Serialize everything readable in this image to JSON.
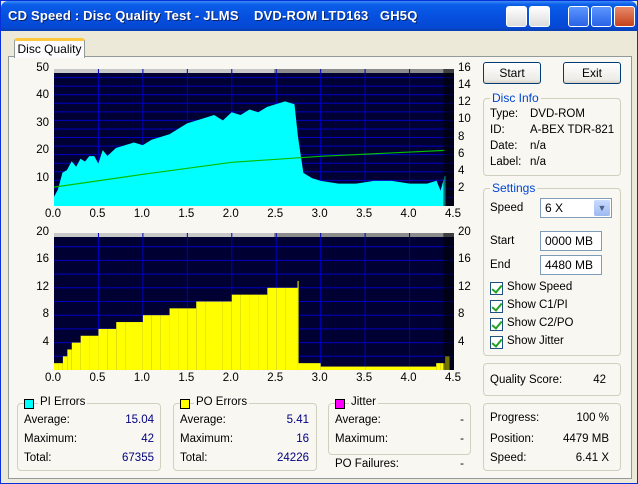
{
  "window": {
    "title": "CD Speed : Disc Quality Test - JLMS    DVD-ROM LTD163   GH5Q"
  },
  "tab": {
    "label": "Disc Quality"
  },
  "buttons": {
    "start": "Start",
    "exit": "Exit"
  },
  "disc_info": {
    "title": "Disc Info",
    "type_label": "Type:",
    "type_value": "DVD-ROM",
    "id_label": "ID:",
    "id_value": "A-BEX TDR-821",
    "date_label": "Date:",
    "date_value": "n/a",
    "label_label": "Label:",
    "label_value": "n/a"
  },
  "settings": {
    "title": "Settings",
    "speed_label": "Speed",
    "speed_value": "6 X",
    "start_label": "Start",
    "start_value": "0000 MB",
    "end_label": "End",
    "end_value": "4480 MB",
    "show_speed": "Show Speed",
    "show_c1pi": "Show C1/PI",
    "show_c2po": "Show C2/PO",
    "show_jitter": "Show Jitter"
  },
  "quality": {
    "label": "Quality Score:",
    "value": "42"
  },
  "progress": {
    "progress_label": "Progress:",
    "progress_value": "100 %",
    "position_label": "Position:",
    "position_value": "4479 MB",
    "speed_label": "Speed:",
    "speed_value": "6.41 X"
  },
  "pi_errors": {
    "title": "PI Errors",
    "avg_label": "Average:",
    "avg": "15.04",
    "max_label": "Maximum:",
    "max": "42",
    "total_label": "Total:",
    "total": "67355"
  },
  "po_errors": {
    "title": "PO Errors",
    "avg_label": "Average:",
    "avg": "5.41",
    "max_label": "Maximum:",
    "max": "16",
    "total_label": "Total:",
    "total": "24226"
  },
  "jitter": {
    "title": "Jitter",
    "avg_label": "Average:",
    "avg": "-",
    "max_label": "Maximum:",
    "max": "-",
    "po_failures_label": "PO Failures:",
    "po_failures": "-"
  },
  "colors": {
    "pi": "#00ffff",
    "po": "#ffff00",
    "jitter": "#ff00ff",
    "speed": "#00c000",
    "plot_bg": "#000033",
    "grid": "#0000c0"
  },
  "chart_data": [
    {
      "type": "area",
      "name": "pi-errors-chart",
      "x_ticks": [
        "0.0",
        "0.5",
        "1.0",
        "1.5",
        "2.0",
        "2.5",
        "3.0",
        "3.5",
        "4.0",
        "4.5"
      ],
      "y_ticks_left": [
        "50",
        "40",
        "30",
        "20",
        "10"
      ],
      "y_ticks_right": [
        "16",
        "14",
        "12",
        "10",
        "8",
        "6",
        "4",
        "2"
      ],
      "xlim": [
        0,
        4.5
      ],
      "ylim": [
        0,
        50
      ],
      "y2lim": [
        0,
        16
      ],
      "series": [
        {
          "x": [
            0.0,
            0.05,
            0.1,
            0.15,
            0.2,
            0.25,
            0.3,
            0.35,
            0.4,
            0.45,
            0.5,
            0.55,
            0.6,
            0.7,
            0.8,
            0.9,
            1.0,
            1.1,
            1.2,
            1.3,
            1.4,
            1.5,
            1.6,
            1.7,
            1.8,
            1.9,
            2.0,
            2.1,
            2.2,
            2.3,
            2.4,
            2.5,
            2.6,
            2.7,
            2.74,
            2.8,
            2.9,
            3.0,
            3.2,
            3.4,
            3.6,
            3.8,
            4.0,
            4.2,
            4.3,
            4.35,
            4.4
          ],
          "y": [
            3,
            6,
            12,
            13,
            16,
            14,
            17,
            16,
            18,
            18,
            15,
            20,
            18,
            21,
            22,
            23,
            22,
            24,
            25,
            26,
            28,
            30,
            31,
            32,
            33,
            31,
            34,
            33,
            35,
            34,
            36,
            37,
            38,
            37,
            25,
            12,
            10,
            9,
            8,
            8,
            9,
            9,
            8,
            8,
            9,
            5,
            11
          ]
        },
        {
          "x": [
            0.0,
            1.0,
            2.0,
            3.0,
            4.0,
            4.4
          ],
          "y": [
            2.2,
            3.7,
            5.1,
            5.8,
            6.3,
            6.5
          ]
        }
      ]
    },
    {
      "type": "bar",
      "name": "po-errors-chart",
      "x_ticks": [
        "0.0",
        "0.5",
        "1.0",
        "1.5",
        "2.0",
        "2.5",
        "3.0",
        "3.5",
        "4.0",
        "4.5"
      ],
      "y_ticks_left": [
        "20",
        "16",
        "12",
        "8",
        "4"
      ],
      "y_ticks_right": [
        "20",
        "16",
        "12",
        "8",
        "4"
      ],
      "xlim": [
        0,
        4.5
      ],
      "ylim": [
        0,
        20
      ],
      "series": [
        {
          "x": [
            0.0,
            0.05,
            0.1,
            0.15,
            0.2,
            0.3,
            0.4,
            0.5,
            0.6,
            0.7,
            0.8,
            0.9,
            1.0,
            1.1,
            1.2,
            1.3,
            1.4,
            1.5,
            1.6,
            1.7,
            1.8,
            1.9,
            2.0,
            2.1,
            2.2,
            2.3,
            2.4,
            2.5,
            2.6,
            2.7,
            2.74,
            2.75,
            3.0,
            3.5,
            4.0,
            4.3,
            4.35,
            4.4
          ],
          "y": [
            1,
            1,
            2,
            3,
            4,
            5,
            5,
            6,
            6,
            7,
            7,
            7,
            8,
            8,
            8,
            9,
            9,
            9,
            10,
            10,
            10,
            10,
            11,
            11,
            11,
            11,
            12,
            12,
            12,
            12,
            13,
            1,
            0.5,
            0.5,
            0.5,
            1,
            1,
            2
          ]
        }
      ]
    }
  ]
}
